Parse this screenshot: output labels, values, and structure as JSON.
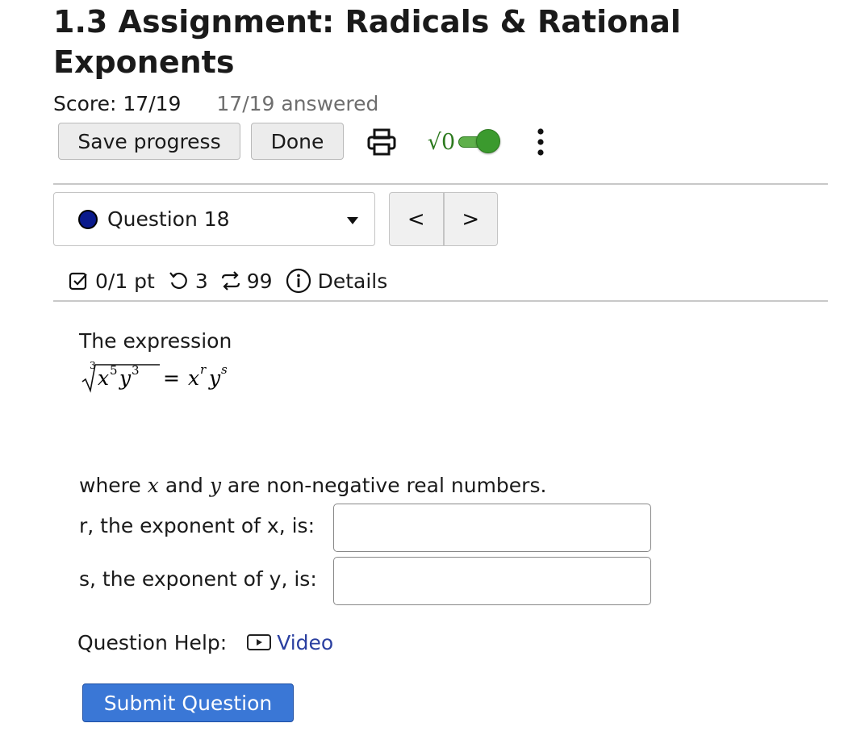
{
  "assignment": {
    "title": "1.3 Assignment: Radicals & Rational Exponents",
    "score": "Score: 17/19",
    "answered": "17/19 answered"
  },
  "toolbar": {
    "save_label": "Save progress",
    "done_label": "Done",
    "math_toggle_label": "√0",
    "math_toggle_on": true
  },
  "question_nav": {
    "current": "Question 18",
    "prev_label": "<",
    "next_label": ">"
  },
  "question_meta": {
    "points": "0/1 pt",
    "retries": "3",
    "attempts": "99",
    "details_label": "Details"
  },
  "question": {
    "intro": "The expression",
    "where_prefix": "where",
    "var_x": "x",
    "and": "and",
    "var_y": "y",
    "where_suffix": "are non-negative real numbers.",
    "r_label": "r, the exponent of x, is:",
    "s_label": "s, the exponent of y, is:",
    "r_value": "",
    "s_value": ""
  },
  "help": {
    "label": "Question Help:",
    "video_label": "Video"
  },
  "submit_label": "Submit Question",
  "colors": {
    "submit_bg": "#3a77d6",
    "toggle_on": "#3b9a2e",
    "question_dot": "#0a1a8c",
    "link": "#2a3fa0"
  },
  "icons": [
    "printer-icon",
    "math-toggle-icon",
    "more-vertical-icon",
    "checkbox-icon",
    "retry-icon",
    "attempts-icon",
    "info-icon",
    "video-icon",
    "caret-down-icon"
  ]
}
